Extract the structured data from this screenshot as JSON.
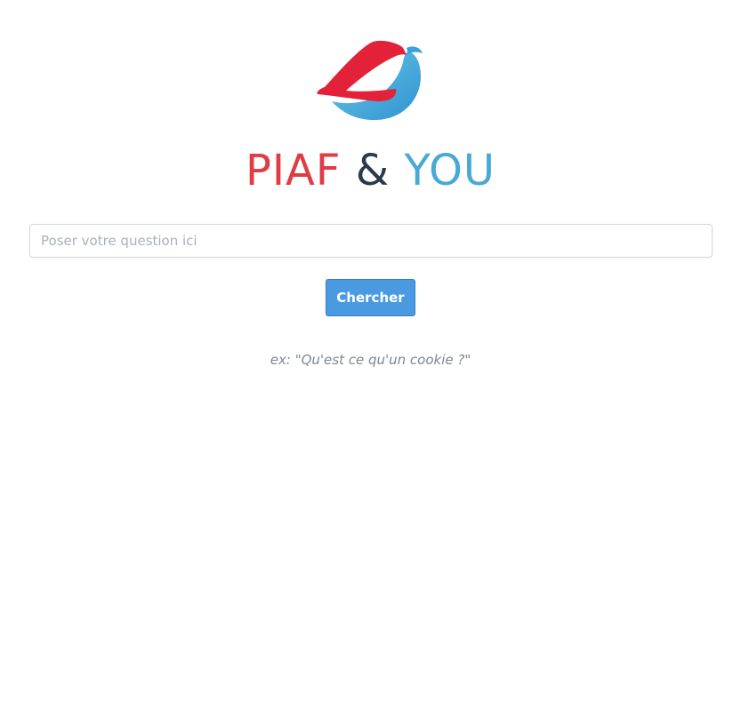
{
  "brand": {
    "logo_icon": "bird-logo-icon",
    "title_part1": "PIAF",
    "title_amp": "&",
    "title_part2": "YOU",
    "colors": {
      "red": "#e03c45",
      "dark": "#2b3a4a",
      "blue": "#48a9d6"
    }
  },
  "search": {
    "placeholder": "Poser votre question ici",
    "value": ""
  },
  "actions": {
    "search_label": "Chercher",
    "button_color": "#4a9ae1"
  },
  "hint": {
    "text": "ex: \"Qu'est ce qu'un cookie ?\""
  }
}
